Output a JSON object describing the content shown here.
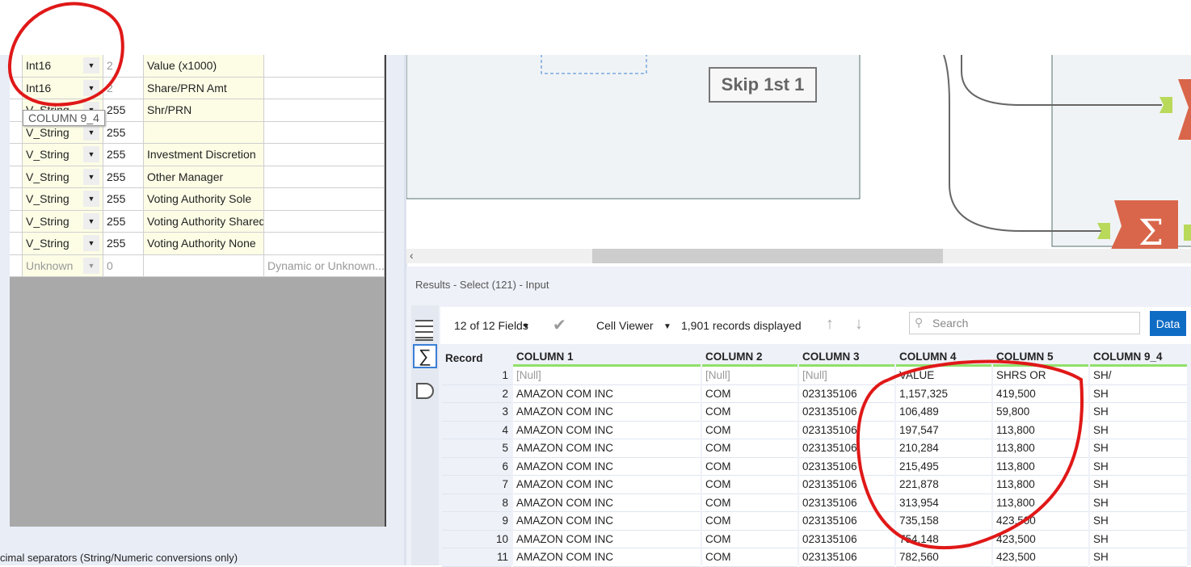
{
  "config_rows": [
    {
      "type": "Int16",
      "size": "2",
      "desc": "Value (x1000)",
      "extra": "",
      "grey_size": true
    },
    {
      "type": "Int16",
      "size": "2",
      "desc": "Share/PRN Amt",
      "extra": "",
      "grey_size": true
    },
    {
      "type": "V_String",
      "size": "255",
      "desc": "Shr/PRN",
      "extra": ""
    },
    {
      "type": "V_String",
      "size": "255",
      "desc": "",
      "extra": ""
    },
    {
      "type": "V_String",
      "size": "255",
      "desc": "Investment Discretion",
      "extra": ""
    },
    {
      "type": "V_String",
      "size": "255",
      "desc": "Other Manager",
      "extra": ""
    },
    {
      "type": "V_String",
      "size": "255",
      "desc": "Voting Authority Sole",
      "extra": ""
    },
    {
      "type": "V_String",
      "size": "255",
      "desc": "Voting Authority Shared",
      "extra": ""
    },
    {
      "type": "V_String",
      "size": "255",
      "desc": "Voting Authority None",
      "extra": ""
    },
    {
      "type": "Unknown",
      "size": "0",
      "desc": "",
      "extra": "Dynamic or Unknown...",
      "unknown": true
    }
  ],
  "tooltip": "COLUMN 9_4",
  "bottom_text": "cimal separators (String/Numeric conversions only)",
  "canvas": {
    "skip_label": "Skip 1st 1",
    "accent": "#d9664a",
    "anchor": "#b8d95a"
  },
  "results": {
    "title": "Results - Select (121) - Input",
    "fields": "12 of 12 Fields",
    "cell_viewer": "Cell Viewer",
    "records": "1,901 records displayed",
    "search_placeholder": "Search",
    "data_button": "Data",
    "columns": [
      "Record",
      "COLUMN 1",
      "COLUMN 2",
      "COLUMN 3",
      "COLUMN 4",
      "COLUMN 5",
      "COLUMN 9_4"
    ],
    "rows": [
      [
        "1",
        "[Null]",
        "[Null]",
        "[Null]",
        "VALUE",
        "SHRS OR",
        "SH/"
      ],
      [
        "2",
        "AMAZON COM INC",
        "COM",
        "023135106",
        "1,157,325",
        "419,500",
        "SH"
      ],
      [
        "3",
        "AMAZON COM INC",
        "COM",
        "023135106",
        "106,489",
        "59,800",
        "SH"
      ],
      [
        "4",
        "AMAZON COM INC",
        "COM",
        "023135106",
        "197,547",
        "113,800",
        "SH"
      ],
      [
        "5",
        "AMAZON COM INC",
        "COM",
        "023135106",
        "210,284",
        "113,800",
        "SH"
      ],
      [
        "6",
        "AMAZON COM INC",
        "COM",
        "023135106",
        "215,495",
        "113,800",
        "SH"
      ],
      [
        "7",
        "AMAZON COM INC",
        "COM",
        "023135106",
        "221,878",
        "113,800",
        "SH"
      ],
      [
        "8",
        "AMAZON COM INC",
        "COM",
        "023135106",
        "313,954",
        "113,800",
        "SH"
      ],
      [
        "9",
        "AMAZON COM INC",
        "COM",
        "023135106",
        "735,158",
        "423,500",
        "SH"
      ],
      [
        "10",
        "AMAZON COM INC",
        "COM",
        "023135106",
        "754,148",
        "423,500",
        "SH"
      ],
      [
        "11",
        "AMAZON COM INC",
        "COM",
        "023135106",
        "782,560",
        "423,500",
        "SH"
      ]
    ]
  }
}
